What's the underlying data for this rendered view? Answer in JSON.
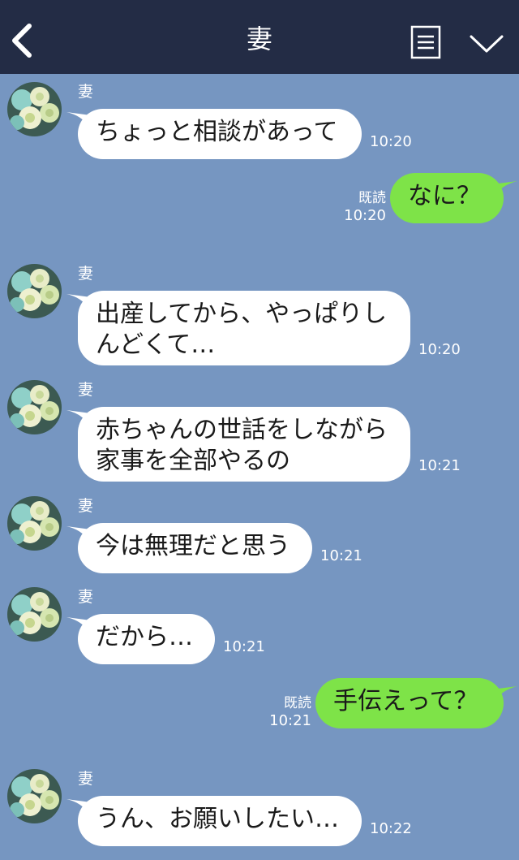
{
  "header": {
    "title": "妻"
  },
  "messages": [
    {
      "side": "in",
      "sender": "妻",
      "text": "ちょっと相談があって",
      "time": "10:20"
    },
    {
      "side": "out",
      "read": "既読",
      "text": "なに？",
      "time": "10:20"
    },
    {
      "side": "in",
      "sender": "妻",
      "text": "出産してから、やっぱりしんどくて…",
      "time": "10:20"
    },
    {
      "side": "in",
      "sender": "妻",
      "text": "赤ちゃんの世話をしながら家事を全部やるの",
      "time": "10:21"
    },
    {
      "side": "in",
      "sender": "妻",
      "text": "今は無理だと思う",
      "time": "10:21"
    },
    {
      "side": "in",
      "sender": "妻",
      "text": "だから…",
      "time": "10:21"
    },
    {
      "side": "out",
      "read": "既読",
      "text": "手伝えって？",
      "time": "10:21"
    },
    {
      "side": "in",
      "sender": "妻",
      "text": "うん、お願いしたい…",
      "time": "10:22"
    }
  ],
  "colors": {
    "header_bg": "#232c45",
    "chat_bg": "#7696c1",
    "incoming_bubble": "#ffffff",
    "outgoing_bubble": "#7ee348"
  },
  "icons": [
    "back-chevron-icon",
    "menu-list-icon",
    "chevron-down-icon",
    "rose-avatar"
  ]
}
